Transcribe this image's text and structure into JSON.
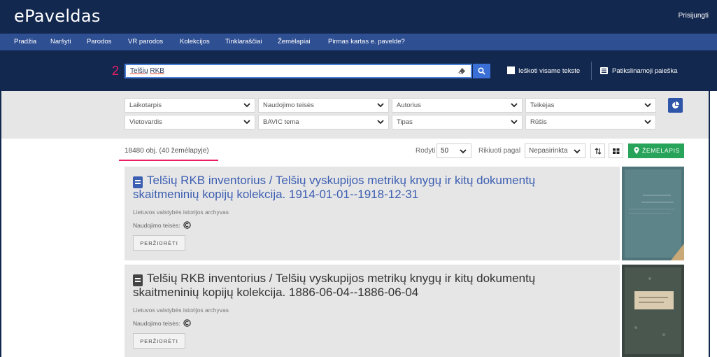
{
  "header": {
    "logo": "ePaveldas",
    "login": "Prisijungti"
  },
  "nav": [
    "Pradžia",
    "Naršyti",
    "Parodos",
    "VR parodos",
    "Kolekcijos",
    "Tinklaraščiai",
    "Žemėlapiai",
    "Pirmas kartas e. pavelde?"
  ],
  "search": {
    "step_number": "2",
    "query_word1": "Telšių",
    "query_word2": "RKB",
    "fulltext_label": "Ieškoti visame tekste",
    "advanced_label": "Patikslinamoji paieška"
  },
  "filters": {
    "row1": [
      "Laikotarpis",
      "Naudojimo teisės",
      "Autorius",
      "Teikėjas"
    ],
    "row2": [
      "Vietovardis",
      "BAVIC tema",
      "Tipas",
      "Rūšis"
    ]
  },
  "results_bar": {
    "count": "18480 obj. (40 žemėlapyje)",
    "show_label": "Rodyti",
    "show_value": "50",
    "sort_label": "Rikiuoti pagal",
    "sort_value": "Nepasirinkta",
    "map_button": "ŽEMĖLAPIS"
  },
  "results": [
    {
      "title": "Telšių RKB inventorius / Telšių vyskupijos metrikų knygų ir kitų dokumentų skaitmeninių kopijų kolekcija. 1914-01-01--1918-12-31",
      "source": "Lietuvos valstybės istorijos archyvas",
      "rights_label": "Naudojimo teisės:",
      "view_button": "PERŽIŪRĖTI"
    },
    {
      "title": "Telšių RKB inventorius / Telšių vyskupijos metrikų knygų ir kitų dokumentų skaitmeninių kopijų kolekcija. 1886-06-04--1886-06-04",
      "source": "Lietuvos valstybės istorijos archyvas",
      "rights_label": "Naudojimo teisės:",
      "view_button": "PERŽIŪRĖTI"
    }
  ],
  "colors": {
    "header_bg": "#13284f",
    "nav_bg": "#2f4f93",
    "link_blue": "#3d5fb2",
    "map_green": "#27a35a",
    "annotation_pink": "#e91e63"
  }
}
